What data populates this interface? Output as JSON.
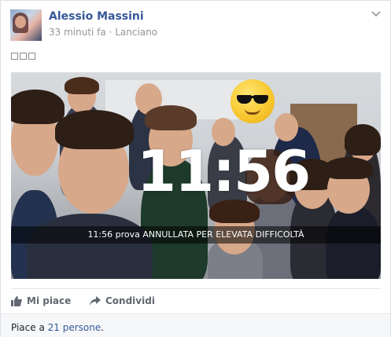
{
  "post": {
    "author": "Alessio Massini",
    "time": "33 minuti fa",
    "separator": "·",
    "location": "Lanciano",
    "photo": {
      "clock_text": "11:56",
      "caption": "11:56 prova ANNULLATA PER ELEVATA DIFFICOLTÀ"
    }
  },
  "actions": {
    "like_label": "Mi piace",
    "share_label": "Condividi"
  },
  "footer": {
    "prefix": "Piace a ",
    "likes_link": "21 persone",
    "suffix": "."
  },
  "colors": {
    "link": "#365899",
    "meta": "#90949c",
    "action": "#616770"
  }
}
